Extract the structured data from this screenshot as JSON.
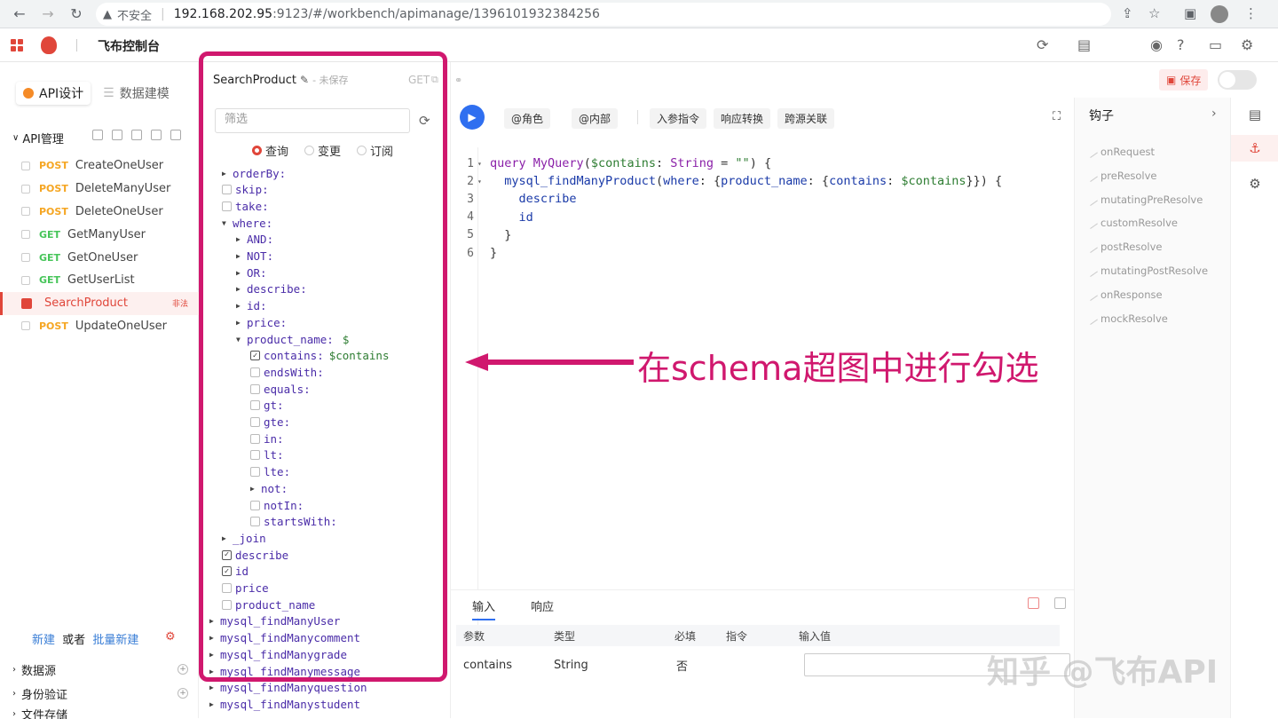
{
  "browser": {
    "security_label": "不安全",
    "url_host": "192.168.202.95",
    "url_path": ":9123/#/workbench/apimanage/1396101932384256"
  },
  "app": {
    "title": "飞布控制台"
  },
  "sidebar": {
    "tabs": [
      {
        "label": "API设计"
      },
      {
        "label": "数据建模"
      }
    ],
    "section_title": "API管理",
    "items": [
      {
        "method": "POST",
        "name": "CreateOneUser"
      },
      {
        "method": "POST",
        "name": "DeleteManyUser"
      },
      {
        "method": "POST",
        "name": "DeleteOneUser"
      },
      {
        "method": "GET",
        "name": "GetManyUser"
      },
      {
        "method": "GET",
        "name": "GetOneUser"
      },
      {
        "method": "GET",
        "name": "GetUserList"
      },
      {
        "method": "",
        "name": "SearchProduct",
        "badge": "非法"
      },
      {
        "method": "POST",
        "name": "UpdateOneUser"
      }
    ],
    "new_label": "新建",
    "or_label": "或者",
    "batch_new_label": "批量新建",
    "sections": [
      {
        "label": "数据源"
      },
      {
        "label": "身份验证"
      },
      {
        "label": "文件存储"
      }
    ]
  },
  "schema": {
    "api_name": "SearchProduct",
    "unsaved_label": "- 未保存",
    "method": "GET",
    "filter_placeholder": "筛选",
    "op_types": [
      {
        "label": "查询",
        "selected": true
      },
      {
        "label": "变更",
        "selected": false
      },
      {
        "label": "订阅",
        "selected": false
      }
    ],
    "tree": [
      {
        "label": "orderBy:",
        "kind": "arrow",
        "indent": 1
      },
      {
        "label": "skip:",
        "kind": "cb",
        "indent": 1
      },
      {
        "label": "take:",
        "kind": "cb",
        "indent": 1
      },
      {
        "label": "where:",
        "kind": "open",
        "indent": 1
      },
      {
        "label": "AND:",
        "kind": "arrow",
        "indent": 2
      },
      {
        "label": "NOT:",
        "kind": "arrow",
        "indent": 2
      },
      {
        "label": "OR:",
        "kind": "arrow",
        "indent": 2
      },
      {
        "label": "describe:",
        "kind": "arrow",
        "indent": 2
      },
      {
        "label": "id:",
        "kind": "arrow",
        "indent": 2
      },
      {
        "label": "price:",
        "kind": "arrow",
        "indent": 2
      },
      {
        "label": "product_name:",
        "kind": "open",
        "indent": 2,
        "suffix": "$"
      },
      {
        "label": "contains:",
        "kind": "cbon",
        "indent": 3,
        "var": "$contains"
      },
      {
        "label": "endsWith:",
        "kind": "cb",
        "indent": 3
      },
      {
        "label": "equals:",
        "kind": "cb",
        "indent": 3
      },
      {
        "label": "gt:",
        "kind": "cb",
        "indent": 3
      },
      {
        "label": "gte:",
        "kind": "cb",
        "indent": 3
      },
      {
        "label": "in:",
        "kind": "cb",
        "indent": 3
      },
      {
        "label": "lt:",
        "kind": "cb",
        "indent": 3
      },
      {
        "label": "lte:",
        "kind": "cb",
        "indent": 3
      },
      {
        "label": "not:",
        "kind": "arrow",
        "indent": 3
      },
      {
        "label": "notIn:",
        "kind": "cb",
        "indent": 3
      },
      {
        "label": "startsWith:",
        "kind": "cb",
        "indent": 3
      },
      {
        "label": "_join",
        "kind": "arrow",
        "indent": 1
      },
      {
        "label": "describe",
        "kind": "cbon",
        "indent": 1
      },
      {
        "label": "id",
        "kind": "cbon",
        "indent": 1
      },
      {
        "label": "price",
        "kind": "cb",
        "indent": 1
      },
      {
        "label": "product_name",
        "kind": "cb",
        "indent": 1
      },
      {
        "label": "mysql_findManyUser",
        "kind": "arrow",
        "indent": 0
      },
      {
        "label": "mysql_findManycomment",
        "kind": "arrow",
        "indent": 0
      },
      {
        "label": "mysql_findManygrade",
        "kind": "arrow",
        "indent": 0
      },
      {
        "label": "mysql_findManymessage",
        "kind": "arrow",
        "indent": 0
      },
      {
        "label": "mysql_findManyquestion",
        "kind": "arrow",
        "indent": 0
      },
      {
        "label": "mysql_findManystudent",
        "kind": "arrow",
        "indent": 0
      }
    ]
  },
  "editor": {
    "toolbar": [
      "@角色",
      "@内部",
      "入参指令",
      "响应转换",
      "跨源关联"
    ],
    "code": [
      {
        "n": "1",
        "fold": "▾"
      },
      {
        "n": "2",
        "fold": "▾"
      },
      {
        "n": "3",
        "fold": ""
      },
      {
        "n": "4",
        "fold": ""
      },
      {
        "n": "5",
        "fold": ""
      },
      {
        "n": "6",
        "fold": ""
      }
    ],
    "bottom_tabs": [
      "输入",
      "响应"
    ],
    "param_headers": [
      "参数",
      "类型",
      "必填",
      "指令",
      "输入值"
    ],
    "param_row": {
      "name": "contains",
      "type": "String",
      "required": "否"
    }
  },
  "hooks": {
    "title": "钩子",
    "items": [
      "onRequest",
      "preResolve",
      "mutatingPreResolve",
      "customResolve",
      "postResolve",
      "mutatingPostResolve",
      "onResponse",
      "mockResolve"
    ]
  },
  "top_right": {
    "save_label": "保存"
  },
  "annotation": {
    "text": "在schema超图中进行勾选",
    "color": "#d0186e"
  },
  "watermark": "知乎 @飞布API",
  "colors": {
    "accent": "#e0463a",
    "run_button": "#2f6ff0",
    "highlight": "#d0186e"
  }
}
